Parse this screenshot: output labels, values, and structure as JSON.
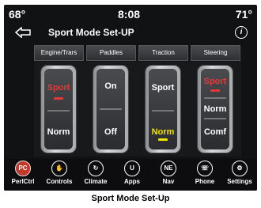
{
  "status": {
    "left_temp": "68°",
    "time": "8:08",
    "right_temp": "71°"
  },
  "header": {
    "title": "Sport Mode Set-UP",
    "info_icon": "info-icon",
    "back_icon": "back-arrow-icon"
  },
  "tabs": [
    "Engine/Trars",
    "Paddles",
    "Traction",
    "Steering"
  ],
  "rockers": [
    {
      "top": "Sport",
      "bottom": "Norm",
      "top_color": "#e23a3a",
      "bottom_color": "#ffffff"
    },
    {
      "top": "On",
      "bottom": "Off",
      "top_color": "#ffffff",
      "bottom_color": "#ffffff"
    },
    {
      "top": "Sport",
      "bottom": "Norm",
      "top_color": "#ffffff",
      "bottom_color": "#f2e500"
    },
    {
      "top": "Sport",
      "middle": "Norm",
      "bottom": "Comf",
      "top_color": "#e23a3a",
      "bottom_color": "#ffffff"
    }
  ],
  "nav": [
    {
      "label": "PerlCtrl",
      "icon": "perfctrl-icon",
      "badge": "PC"
    },
    {
      "label": "Controls",
      "icon": "controls-icon",
      "badge": "✋"
    },
    {
      "label": "Climate",
      "icon": "climate-icon",
      "badge": "↻"
    },
    {
      "label": "Apps",
      "icon": "apps-icon",
      "badge": "U"
    },
    {
      "label": "Nav",
      "icon": "nav-icon",
      "badge": "NE"
    },
    {
      "label": "Phone",
      "icon": "phone-icon",
      "badge": "☏"
    },
    {
      "label": "Settings",
      "icon": "settings-icon",
      "badge": "⚙"
    }
  ],
  "caption": "Sport Mode Set-Up",
  "colors": {
    "accent_red": "#e23a3a",
    "accent_yellow": "#f2e500"
  }
}
